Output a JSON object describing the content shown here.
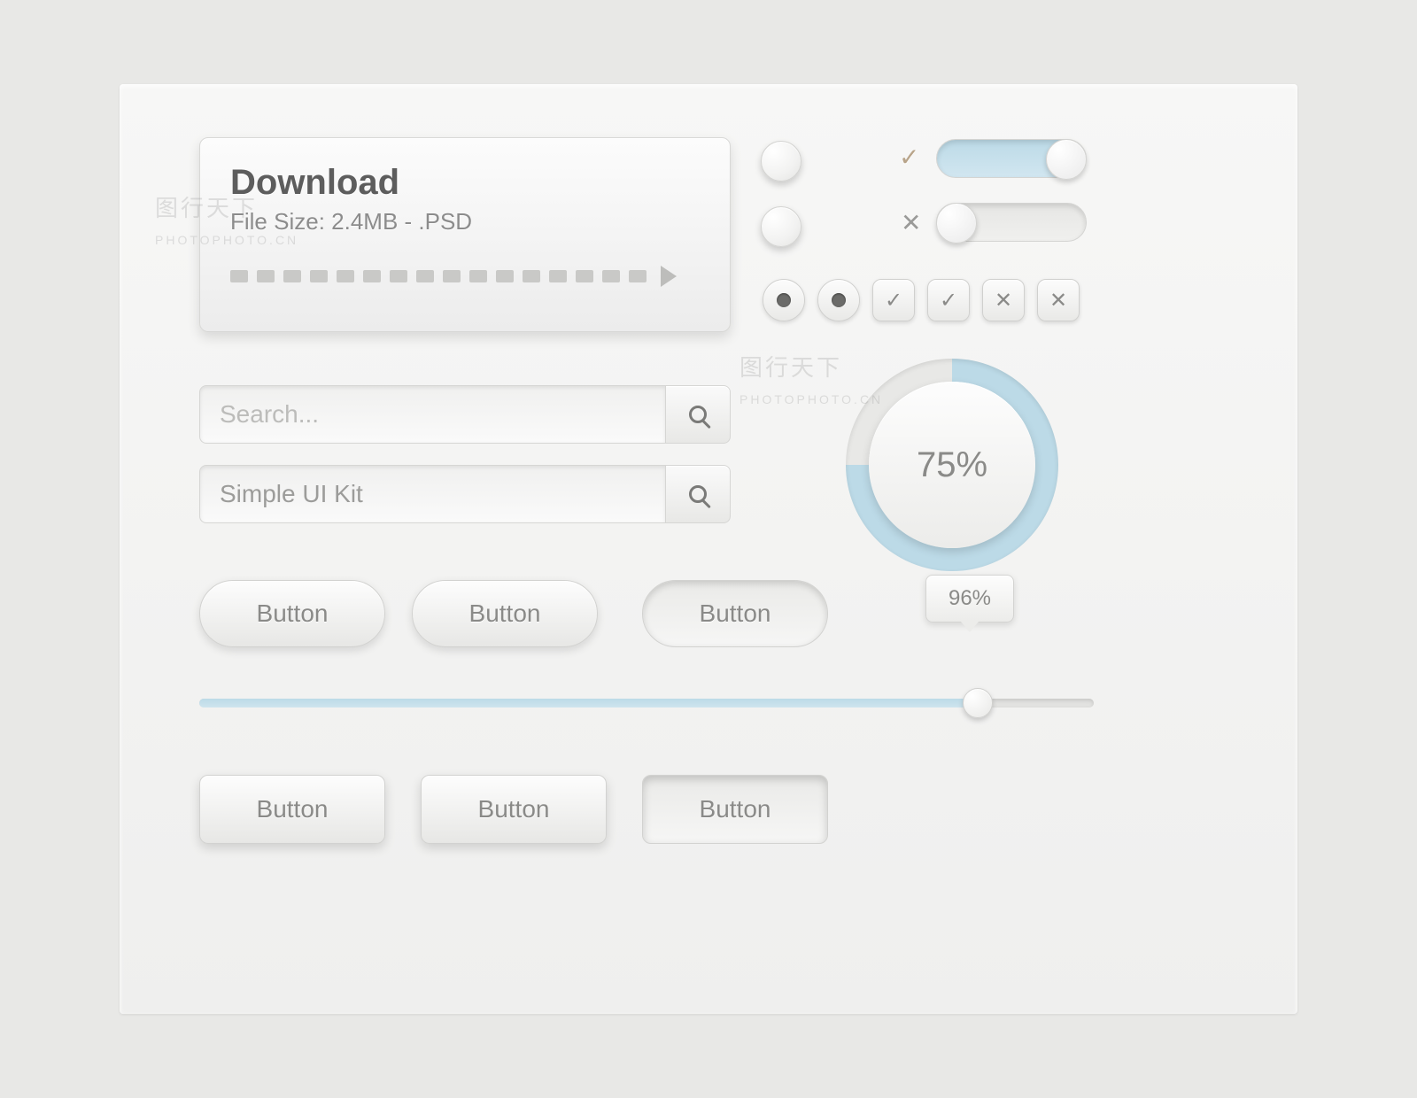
{
  "download": {
    "title": "Download",
    "subtitle": "File Size: 2.4MB - .PSD"
  },
  "toggles": {
    "on_mark": "✓",
    "off_mark": "✕"
  },
  "mini_buttons": {
    "check": "✓",
    "cross": "✕"
  },
  "search": {
    "placeholder": "Search...",
    "value": "Simple UI Kit"
  },
  "progress_ring": {
    "percent": 75,
    "label": "75%"
  },
  "pill_buttons": [
    "Button",
    "Button",
    "Button"
  ],
  "slider": {
    "tooltip": "96%",
    "percent": 96
  },
  "rect_buttons": [
    "Button",
    "Button",
    "Button"
  ],
  "colors": {
    "accent": "#bcdae7",
    "text": "#8a8a88"
  },
  "watermark": {
    "brand_cn": "图行天下",
    "brand_en": "PHOTOPHOTO.CN"
  }
}
